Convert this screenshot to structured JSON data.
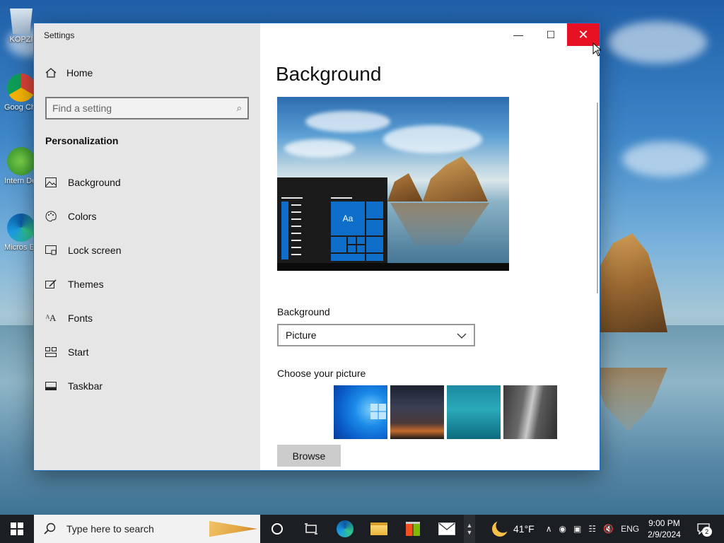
{
  "desktop": {
    "icons": [
      {
        "label": "KOPZI",
        "icon": "recycle-bin-icon"
      },
      {
        "label": "Goog Chrom",
        "icon": "chrome-icon"
      },
      {
        "label": "Intern Downl",
        "icon": "internet-download-manager-icon"
      },
      {
        "label": "Micros Edg",
        "icon": "edge-icon"
      }
    ]
  },
  "window": {
    "title": "Settings",
    "controls": {
      "minimize": "—",
      "maximize": "☐",
      "close": "✕"
    },
    "sidebar": {
      "home_label": "Home",
      "search_placeholder": "Find a setting",
      "section_title": "Personalization",
      "items": [
        {
          "label": "Background",
          "icon": "picture-icon"
        },
        {
          "label": "Colors",
          "icon": "palette-icon"
        },
        {
          "label": "Lock screen",
          "icon": "lock-screen-icon"
        },
        {
          "label": "Themes",
          "icon": "brush-icon"
        },
        {
          "label": "Fonts",
          "icon": "fonts-icon"
        },
        {
          "label": "Start",
          "icon": "start-tiles-icon"
        },
        {
          "label": "Taskbar",
          "icon": "taskbar-icon"
        }
      ]
    },
    "content": {
      "page_title": "Background",
      "preview_tile_text": "Aa",
      "background_label": "Background",
      "background_value": "Picture",
      "choose_picture_label": "Choose your picture",
      "browse_label": "Browse"
    }
  },
  "taskbar": {
    "search_placeholder": "Type here to search",
    "apps": [
      "cortana-icon",
      "task-view-icon",
      "edge-icon",
      "file-explorer-icon",
      "store-icon",
      "mail-icon"
    ],
    "weather": {
      "temp": "41°F",
      "icon": "weather-moon-cloud-icon"
    },
    "tray": {
      "language": "ENG"
    },
    "clock": {
      "time": "9:00 PM",
      "date": "2/9/2024"
    },
    "notifications_count": "2"
  },
  "colors": {
    "accent": "#0f6ec9",
    "close_red": "#e81123",
    "sidebar_bg": "#e6e6e6"
  }
}
